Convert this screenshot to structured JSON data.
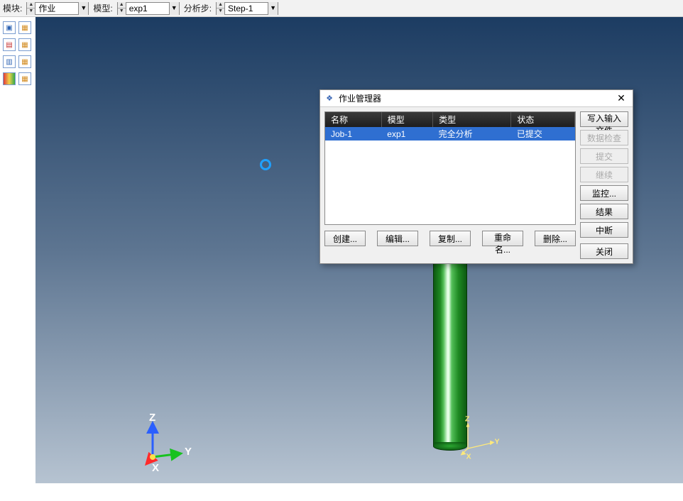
{
  "topbar": {
    "module_label": "模块:",
    "module_value": "作业",
    "model_label": "模型:",
    "model_value": "exp1",
    "step_label": "分析步:",
    "step_value": "Step-1"
  },
  "dialog": {
    "title": "作业管理器",
    "columns": {
      "name": "名称",
      "model": "模型",
      "type": "类型",
      "status": "状态"
    },
    "rows": [
      {
        "name": "Job-1",
        "model": "exp1",
        "type": "完全分析",
        "status": "已提交"
      }
    ],
    "side_buttons": {
      "write_input": "写入输入文件",
      "data_check": "数据检查",
      "submit": "提交",
      "continue": "继续",
      "monitor": "监控...",
      "results": "结果",
      "kill": "中断"
    },
    "footer_buttons": {
      "create": "创建...",
      "edit": "编辑...",
      "copy": "复制...",
      "rename": "重命名...",
      "delete": "删除...",
      "dismiss": "关闭"
    }
  },
  "axes": {
    "x": "X",
    "y": "Y",
    "z": "Z"
  },
  "local_axes": {
    "x": "X",
    "y": "Y",
    "z": "Z"
  }
}
